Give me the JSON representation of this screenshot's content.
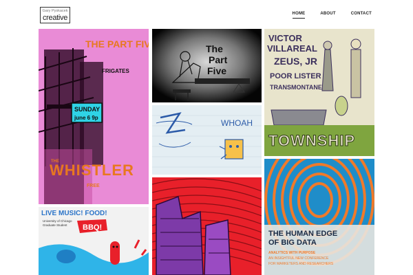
{
  "header": {
    "logo_top": "Gary Pyskacek",
    "logo_bottom": "creative",
    "nav": [
      {
        "label": "HOME",
        "active": true
      },
      {
        "label": "ABOUT",
        "active": false
      },
      {
        "label": "CONTACT",
        "active": false
      }
    ]
  },
  "gallery": {
    "part_five_poster": {
      "line1": "THE PART FIVE",
      "line2": "FRIGATES",
      "date1": "SUNDAY",
      "date2": "june 6 9p",
      "venue_prefix": "THE",
      "venue": "WHISTLER",
      "price": "FREE"
    },
    "part_five_sketch": {
      "line1": "The",
      "line2": "Part",
      "line3": "Five"
    },
    "township_poster": {
      "line1": "VICTOR",
      "line2": "VILLAREAL",
      "line3": "ZEUS, JR",
      "line4": "POOR LISTER",
      "line5": "TRANSMONTANE",
      "title": "TOWNSHIP"
    },
    "whoah_sketch": {
      "text": "WHOAH"
    },
    "big_data_poster": {
      "title1": "THE HUMAN EDGE",
      "title2": "OF BIG DATA",
      "sub1": "ANALYTICS WITH PURPOSE",
      "sub2": "AN INSIGHTFUL NEW CONFERENCE",
      "sub3": "FOR MARKETERS AND RESEARCHERS"
    },
    "bbq_poster": {
      "headline": "LIVE MUSIC! FOOD!",
      "line1": "University of Chicago",
      "line2": "Graduate Student",
      "bbq": "BBQ!"
    }
  },
  "colors": {
    "pink": "#e98bd6",
    "orange": "#e8781f",
    "cyan": "#2fd3e6",
    "red": "#e8202a",
    "blue": "#1f8dc9",
    "grass": "#7fa53f"
  }
}
